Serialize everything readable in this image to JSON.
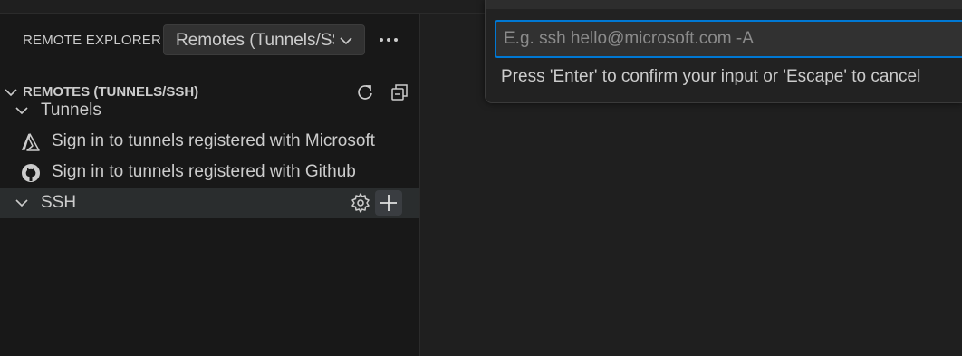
{
  "view_header": {
    "title": "REMOTE EXPLORER",
    "select_value": "Remotes (Tunnels/SSH)",
    "more_icon": "ellipsis-icon"
  },
  "section": {
    "title": "REMOTES (TUNNELS/SSH)",
    "actions": [
      "refresh-icon",
      "collapse-all-icon"
    ]
  },
  "tree": {
    "tunnels_label": "Tunnels",
    "microsoft_item": "Sign in to tunnels registered with Microsoft",
    "github_item": "Sign in to tunnels registered with Github",
    "ssh_label": "SSH",
    "ssh_actions": [
      "gear-icon",
      "add-icon"
    ]
  },
  "quick_input": {
    "placeholder": "E.g. ssh hello@microsoft.com -A",
    "value": "",
    "message": "Press 'Enter' to confirm your input or 'Escape' to cancel"
  },
  "colors": {
    "background": "#181818",
    "focus_border": "#0078d4",
    "text": "#cccccc"
  }
}
